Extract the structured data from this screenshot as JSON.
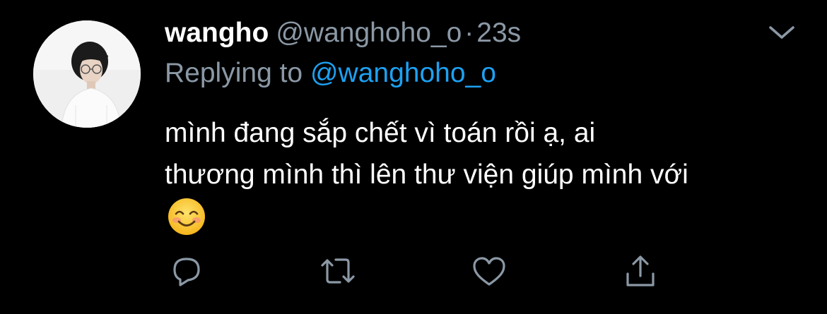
{
  "tweet": {
    "display_name": "wangho",
    "handle": "@wanghoho_o",
    "separator": "·",
    "time": "23s",
    "replying_prefix": "Replying to",
    "replying_to": "@wanghoho_o",
    "text_line_1": "mình đang sắp chết vì toán rồi ạ, ai",
    "text_line_2": "thương mình thì lên thư viện giúp mình với",
    "emoji": "smiling-face-with-smiling-eyes"
  },
  "icons": {
    "caret": "chevron-down-icon",
    "reply": "reply-icon",
    "retweet": "retweet-icon",
    "like": "heart-icon",
    "share": "share-icon"
  },
  "colors": {
    "background": "#000000",
    "primary_text": "#ffffff",
    "secondary_text": "#8b98a5",
    "accent": "#1da1f2",
    "icon_gray": "#8b98a5"
  }
}
